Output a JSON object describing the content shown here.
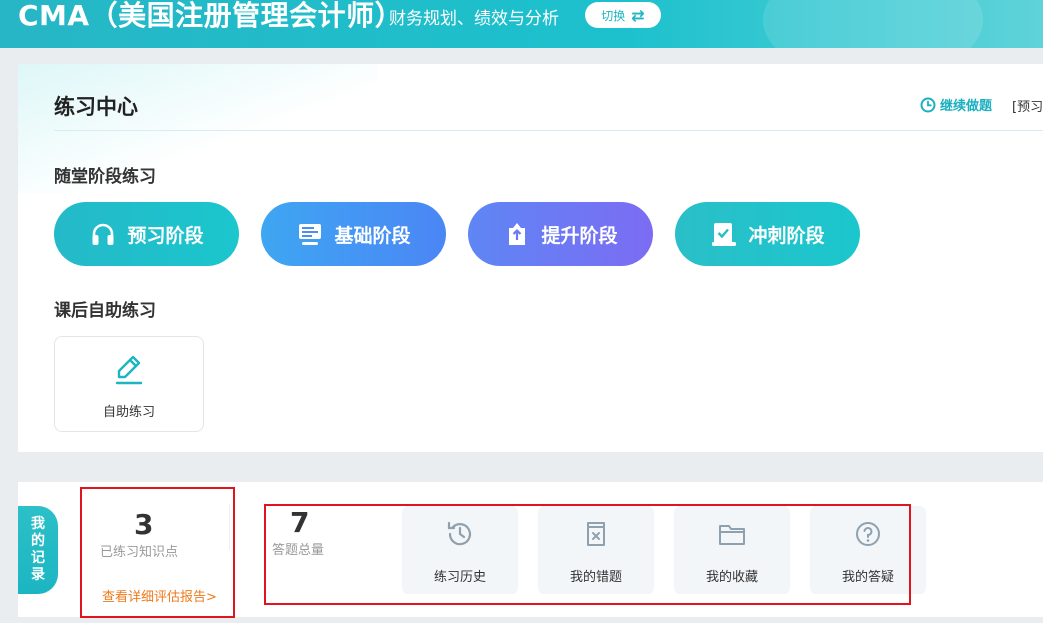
{
  "banner": {
    "title": "CMA（美国注册管理会计师）",
    "subtitle": "财务规划、绩效与分析",
    "switch_label": "切换",
    "switch_icon": "⇄"
  },
  "practice": {
    "title": "练习中心",
    "continue_label": "继续做题",
    "preview_tag": "[预习",
    "stage_section_title": "随堂阶段练习",
    "stages": [
      {
        "label": "预习阶段",
        "icon": "headphones-icon"
      },
      {
        "label": "基础阶段",
        "icon": "monitor-icon"
      },
      {
        "label": "提升阶段",
        "icon": "upload-box-icon"
      },
      {
        "label": "冲刺阶段",
        "icon": "checklist-icon"
      }
    ],
    "self_section_title": "课后自助练习",
    "self_practice_label": "自助练习"
  },
  "records": {
    "tab_label": [
      "我",
      "的",
      "记",
      "录"
    ],
    "knowledge_count": "3",
    "knowledge_caption": "已练习知识点",
    "report_link": "查看详细评估报告>",
    "answer_count": "7",
    "answer_caption": "答题总量",
    "actions": [
      {
        "label": "练习历史",
        "icon": "history-icon"
      },
      {
        "label": "我的错题",
        "icon": "wrong-question-icon"
      },
      {
        "label": "我的收藏",
        "icon": "folder-icon"
      },
      {
        "label": "我的答疑",
        "icon": "question-icon"
      }
    ]
  },
  "colors": {
    "accent": "#1bb6c2",
    "highlight": "#e0141c",
    "link_orange": "#ee7a1c"
  }
}
